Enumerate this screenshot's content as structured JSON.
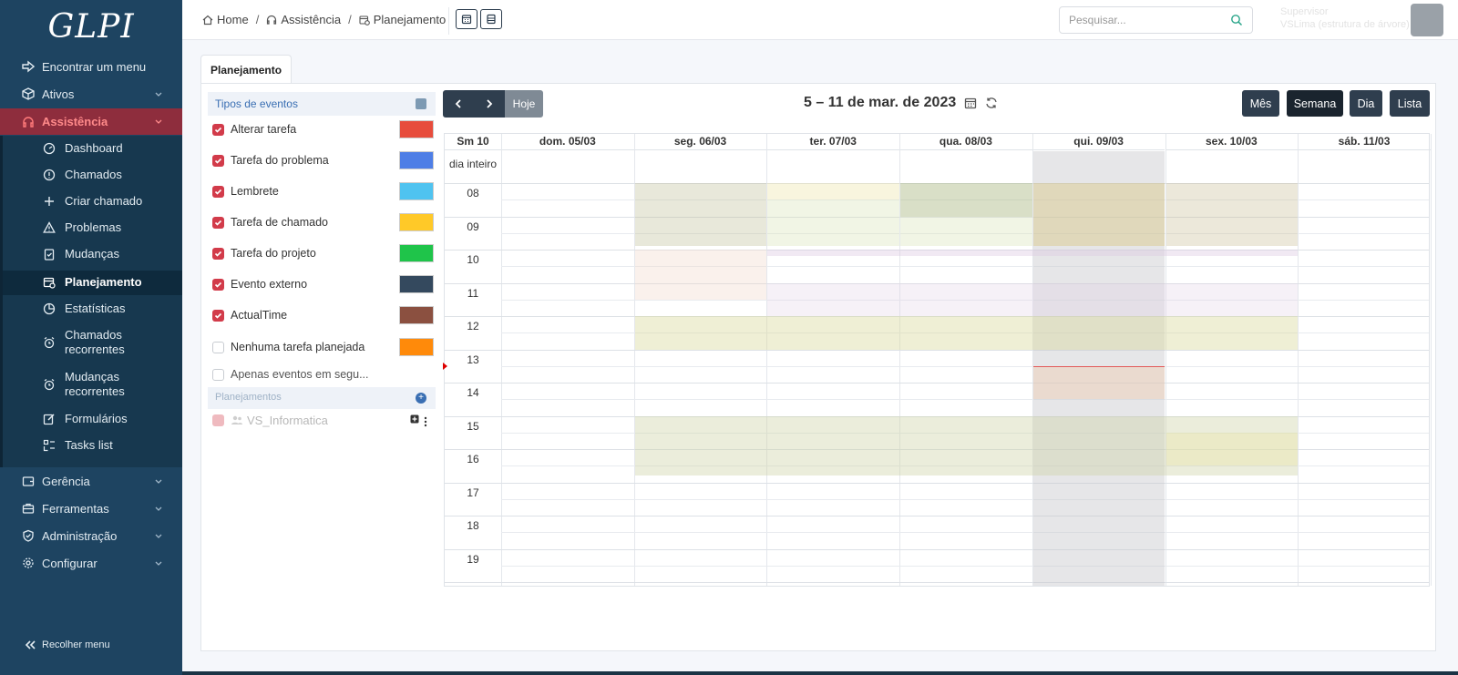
{
  "sidebar": {
    "logo": "GLPI",
    "find_menu": "Encontrar um menu",
    "groups": {
      "ativos": "Ativos",
      "assistencia": "Assistência",
      "gerencia": "Gerência",
      "ferramentas": "Ferramentas",
      "administracao": "Administração",
      "configurar": "Configurar"
    },
    "sub": {
      "dashboard": "Dashboard",
      "chamados": "Chamados",
      "criar_chamado": "Criar chamado",
      "problemas": "Problemas",
      "mudancas": "Mudanças",
      "planejamento": "Planejamento",
      "estatisticas": "Estatísticas",
      "chamados_rec_1": "Chamados",
      "chamados_rec_2": "recorrentes",
      "mudancas_rec_1": "Mudanças",
      "mudancas_rec_2": "recorrentes",
      "formularios": "Formulários",
      "tasks_list": "Tasks list"
    },
    "collapse": "Recolher menu"
  },
  "header": {
    "breadcrumb": {
      "home": "Home",
      "assistencia": "Assistência",
      "planejamento": "Planejamento"
    },
    "search_placeholder": "Pesquisar...",
    "user_name": "Supervisor",
    "user_entity": "VSLima (estrutura de árvore)"
  },
  "tab": {
    "label": "Planejamento"
  },
  "filters": {
    "header": "Tipos de eventos",
    "items": [
      {
        "label": "Alterar tarefa",
        "color": "#e74c3c",
        "checked": true
      },
      {
        "label": "Tarefa do problema",
        "color": "#4e7ee6",
        "checked": true
      },
      {
        "label": "Lembrete",
        "color": "#4fc3f0",
        "checked": true
      },
      {
        "label": "Tarefa de chamado",
        "color": "#ffc928",
        "checked": true
      },
      {
        "label": "Tarefa do projeto",
        "color": "#1fc44a",
        "checked": true
      },
      {
        "label": "Evento externo",
        "color": "#34495e",
        "checked": true
      },
      {
        "label": "ActualTime",
        "color": "#8b5040",
        "checked": true
      },
      {
        "label": "Nenhuma tarefa planejada",
        "color": "#ff8a0a",
        "checked": false
      }
    ],
    "only_following": "Apenas eventos em segu...",
    "plannings_header": "Planejamentos",
    "planning_item": "VS_Informatica"
  },
  "calendar": {
    "today_label": "Hoje",
    "title": "5 – 11 de mar. de 2023",
    "views": {
      "month": "Mês",
      "week": "Semana",
      "day": "Dia",
      "list": "Lista"
    },
    "week_label": "Sm 10",
    "allday_label": "dia inteiro",
    "days": [
      "dom. 05/03",
      "seg. 06/03",
      "ter. 07/03",
      "qua. 08/03",
      "qui. 09/03",
      "sex. 10/03",
      "sáb. 11/03"
    ],
    "hours": [
      "08",
      "09",
      "10",
      "11",
      "12",
      "13",
      "14",
      "15",
      "16",
      "17",
      "18",
      "19"
    ]
  }
}
